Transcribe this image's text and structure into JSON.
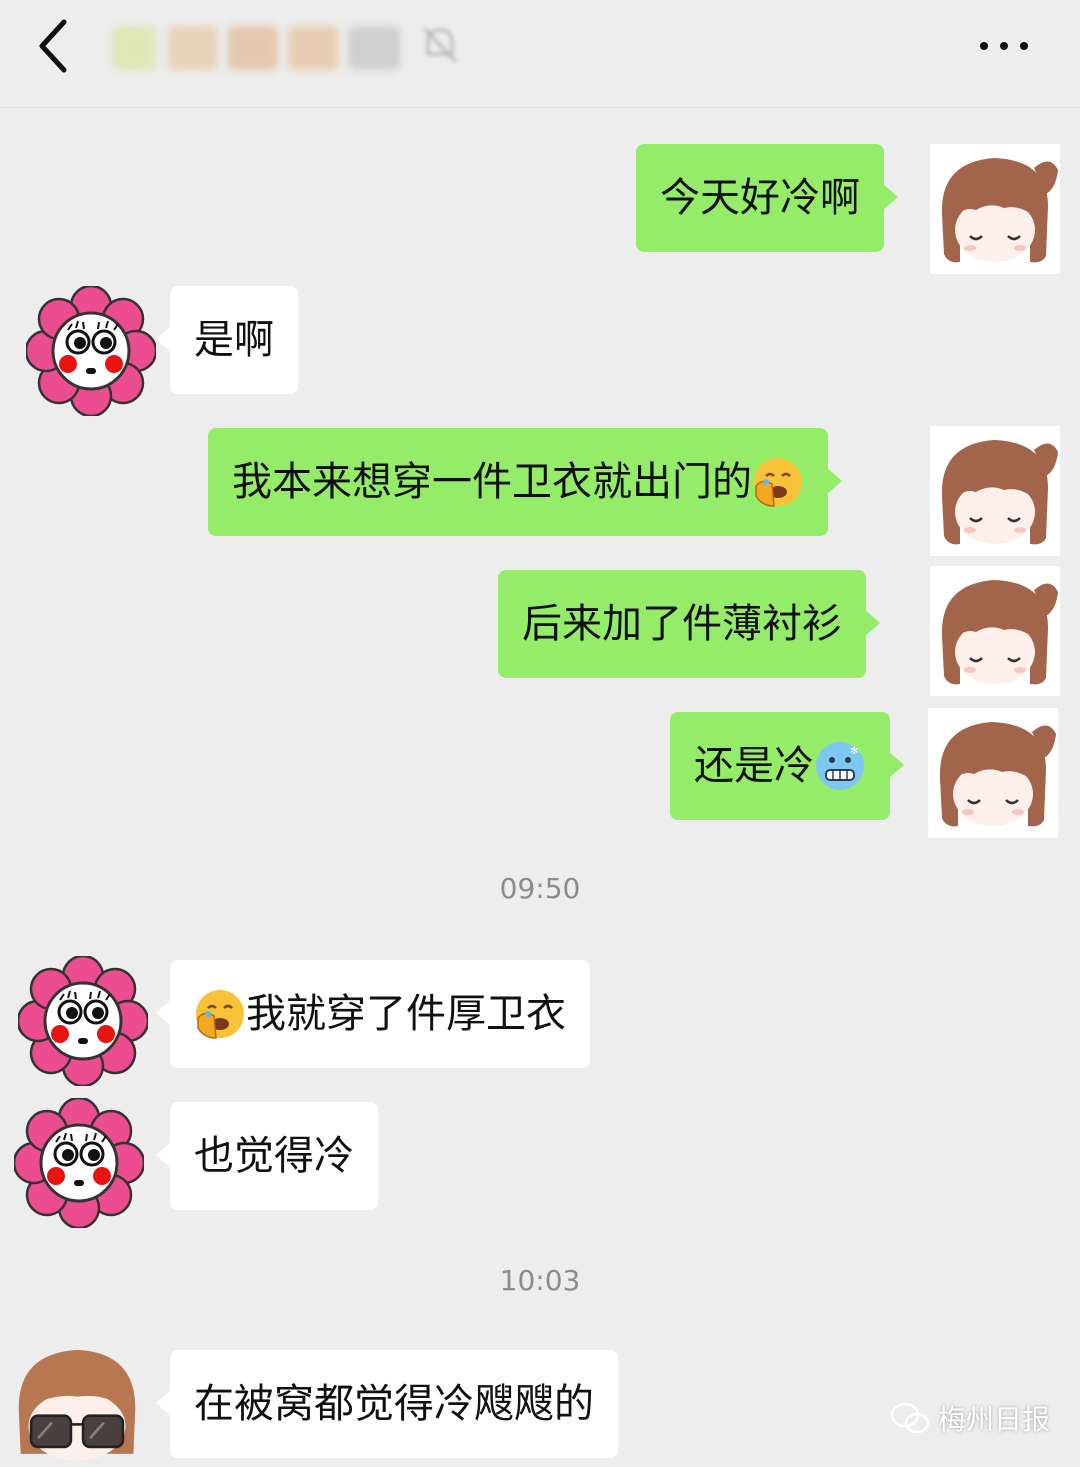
{
  "header": {
    "title": "",
    "back_icon": "chevron-left-icon",
    "more_icon": "more-dots-icon"
  },
  "colors": {
    "sent_bubble": "#95ec69",
    "received_bubble": "#ffffff",
    "background": "#ededed",
    "timestamp": "#8c8c8c"
  },
  "messages": [
    {
      "side": "me",
      "text": "今天好冷啊"
    },
    {
      "side": "other",
      "text": "是啊"
    },
    {
      "side": "me",
      "text": "我本来想穿一件卫衣就出门的",
      "emoji_after": "facepalm-emoji"
    },
    {
      "side": "me",
      "text": "后来加了件薄衬衫"
    },
    {
      "side": "me",
      "text": "还是冷",
      "emoji_after": "cold-face-emoji"
    },
    {
      "side": "other",
      "text": "我就穿了件厚卫衣",
      "emoji_before": "facepalm-emoji"
    },
    {
      "side": "other",
      "text": "也觉得冷"
    },
    {
      "side": "other",
      "text": "在被窝都觉得冷飕飕的"
    }
  ],
  "timestamps": [
    "09:50",
    "10:03"
  ],
  "watermark": {
    "text": "梅州日报",
    "icon": "wechat-official-account-icon"
  }
}
